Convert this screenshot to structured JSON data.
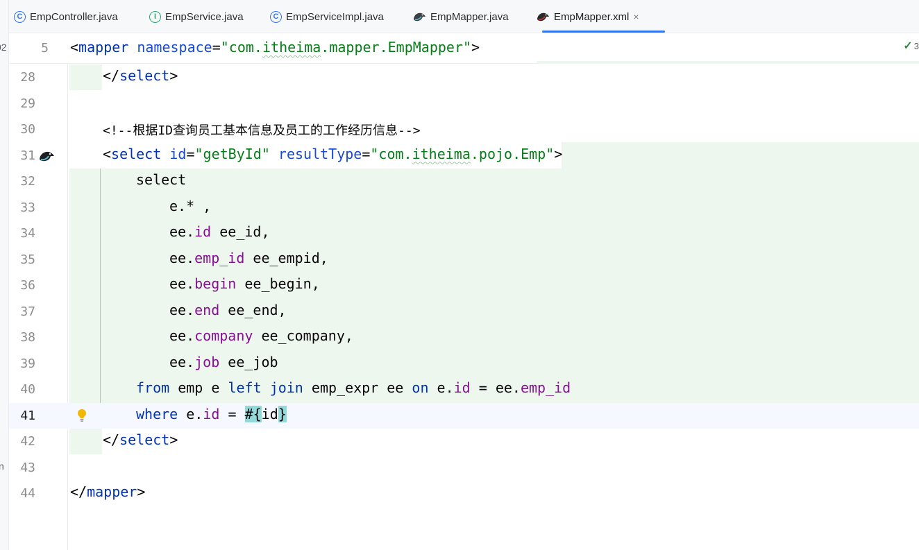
{
  "tabs": [
    {
      "label": "EmpController.java",
      "icon": "class-icon",
      "icon_glyph": "C",
      "active": false
    },
    {
      "label": "EmpService.java",
      "icon": "interface-icon",
      "icon_glyph": "I",
      "active": false
    },
    {
      "label": "EmpServiceImpl.java",
      "icon": "class-icon",
      "icon_glyph": "C",
      "active": false
    },
    {
      "label": "EmpMapper.java",
      "icon": "mybatis-bird-icon",
      "active": false
    },
    {
      "label": "EmpMapper.xml",
      "icon": "mybatis-bird-icon",
      "active": true,
      "close": "×"
    }
  ],
  "left_strip": {
    "top_clip": "02",
    "mid_clip": "n"
  },
  "inspection": {
    "icon": "check-icon",
    "glyph": "✓",
    "count": "3"
  },
  "sticky": {
    "line": "5",
    "open": "<",
    "tag": "mapper",
    "sp": " ",
    "attr": "namespace",
    "eq": "=",
    "q1": "\"com.",
    "wavy": "itheima",
    "q2": ".mapper.EmpMapper\"",
    "close": ">"
  },
  "editor": {
    "line_numbers": [
      "28",
      "29",
      "30",
      "31",
      "32",
      "33",
      "34",
      "35",
      "36",
      "37",
      "38",
      "39",
      "40",
      "41",
      "42",
      "43",
      "44"
    ],
    "l28": {
      "open": "</",
      "tag": "select",
      "close": ">"
    },
    "l30": {
      "comment": "<!--根据ID查询员工基本信息及员工的工作经历信息-->"
    },
    "l31": {
      "open": "<",
      "tag": "select",
      "sp1": " ",
      "attr1": "id",
      "eq1": "=",
      "val1": "\"getById\"",
      "sp2": " ",
      "attr2": "resultType",
      "eq2": "=",
      "val2a": "\"com.",
      "val2w": "itheima",
      "val2b": ".pojo.Emp\"",
      "close": ">"
    },
    "l32": {
      "kw": "select"
    },
    "l33": {
      "text": "e.* ,"
    },
    "l34": {
      "pre": "ee.",
      "field": "id",
      "post": " ee_id,"
    },
    "l35": {
      "pre": "ee.",
      "field": "emp_id",
      "post": " ee_empid,"
    },
    "l36": {
      "pre": "ee.",
      "field": "begin",
      "post": " ee_begin,"
    },
    "l37": {
      "pre": "ee.",
      "field": "end",
      "post": " ee_end,"
    },
    "l38": {
      "pre": "ee.",
      "field": "company",
      "post": " ee_company,"
    },
    "l39": {
      "pre": "ee.",
      "field": "job",
      "post": " ee_job"
    },
    "l40": {
      "kw1": "from",
      "t1": " emp e ",
      "kw2": "left",
      "sp": " ",
      "kw3": "join",
      "t2": " emp_expr ee ",
      "kw4": "on",
      "t3": " e.",
      "f1": "id",
      "t4": " = ee.",
      "f2": "emp_id"
    },
    "l41": {
      "kw": "where",
      "t1": " e.",
      "f1": "id",
      "t2": " = ",
      "h1": "#{",
      "mid": "id",
      "h2": "}"
    },
    "l42": {
      "open": "</",
      "tag": "select",
      "close": ">"
    },
    "l44": {
      "open": "</",
      "tag": "mapper",
      "close": ">"
    }
  }
}
